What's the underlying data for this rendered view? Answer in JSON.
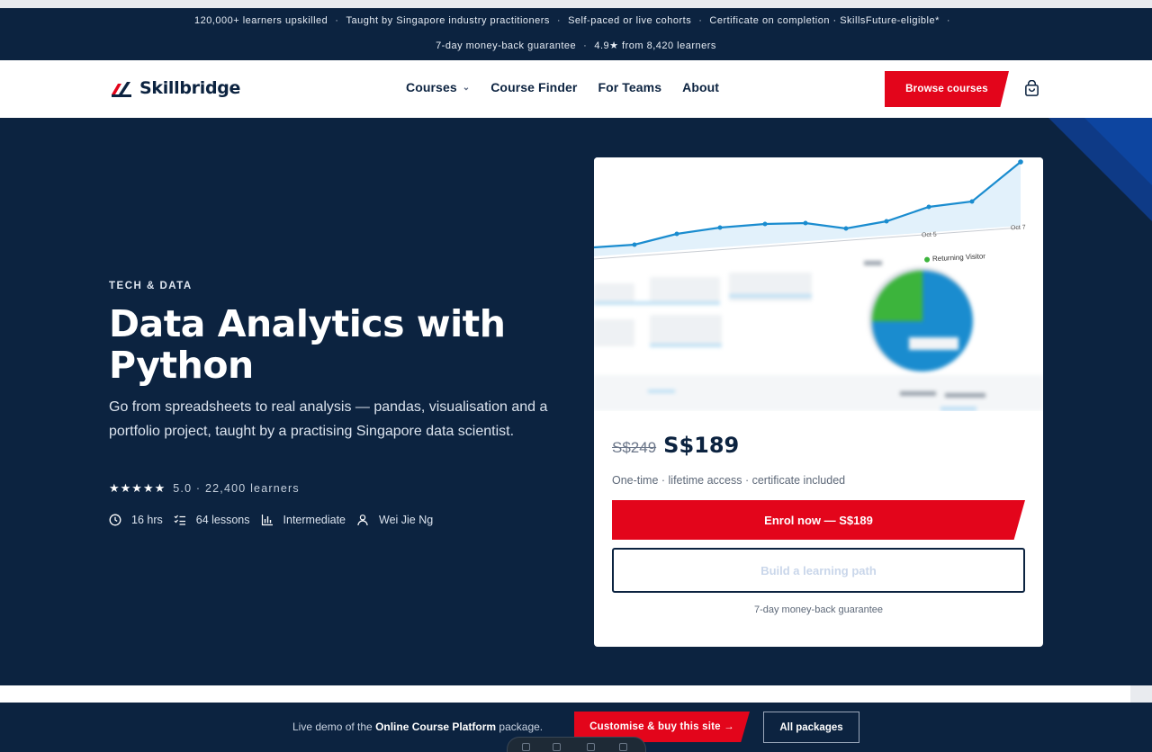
{
  "announcement": {
    "items_row1": [
      "120,000+ learners upskilled",
      "Taught by Singapore industry practitioners",
      "Self-paced or live cohorts",
      "Certificate on completion · SkillsFuture-eligible*"
    ],
    "items_row2": [
      "7-day money-back guarantee",
      "4.9★ from 8,420 learners"
    ]
  },
  "nav": {
    "brand": "Skillbridge",
    "menu": [
      {
        "label": "Courses",
        "has_dropdown": true
      },
      {
        "label": "Course Finder"
      },
      {
        "label": "For Teams"
      },
      {
        "label": "About"
      }
    ],
    "cta": "Browse courses",
    "cart_icon": "shopping-bag-icon"
  },
  "hero": {
    "eyebrow": "TECH & DATA",
    "title": "Data Analytics with Python",
    "description": "Go from spreadsheets to real analysis — pandas, visualisation and a portfolio project, taught by a practising Singapore data scientist.",
    "stars": "★★★★★",
    "rating_text": "5.0 · 22,400 learners",
    "meta": {
      "duration": "16 hrs",
      "lessons": "64 lessons",
      "level": "Intermediate",
      "instructor": "Wei Jie Ng"
    }
  },
  "card": {
    "preview": {
      "legend_returning": "Returning Visitor",
      "label_oct5": "Oct 5",
      "label_oct7": "Oct 7"
    },
    "price_old": "S$249",
    "price_new": "S$189",
    "price_note": "One-time · lifetime access · certificate included",
    "enrol_label": "Enrol now — S$189",
    "path_label": "Build a learning path",
    "guarantee": "7-day money-back guarantee"
  },
  "demo_bar": {
    "prefix": "Live demo of the ",
    "package_name": "Online Course Platform",
    "suffix": " package.",
    "customise_label": "Customise & buy this site →",
    "packages_label": "All packages"
  },
  "colors": {
    "navy": "#0c2340",
    "accent_red": "#e3051b",
    "white": "#ffffff",
    "chart_blue": "#1a8ccf",
    "pie_green": "#3cb43c"
  }
}
